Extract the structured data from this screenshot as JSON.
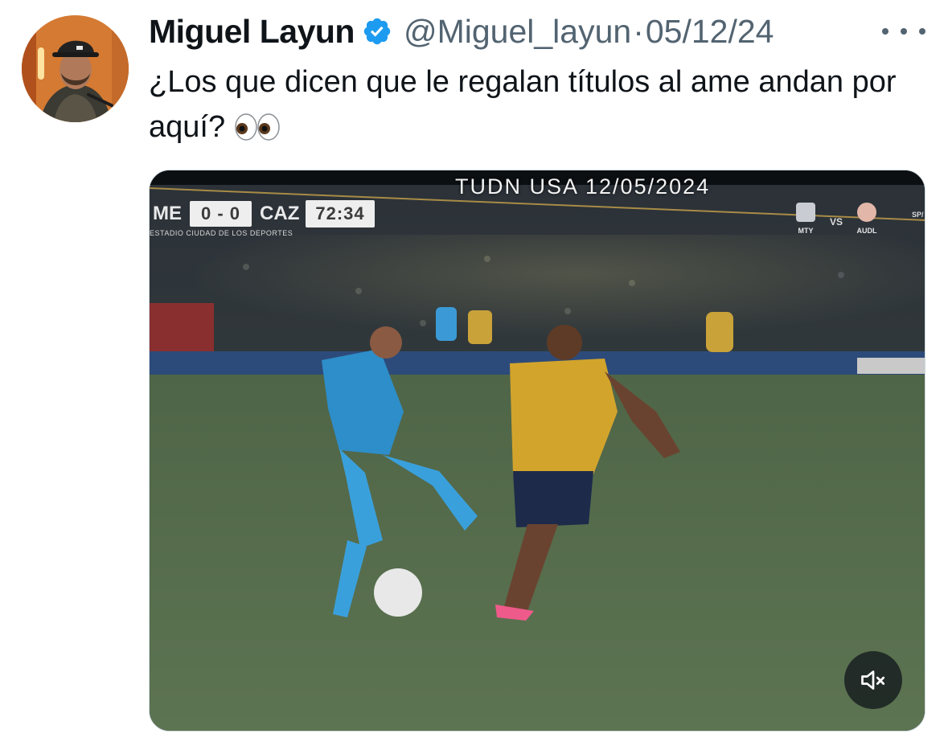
{
  "tweet": {
    "author_name": "Miguel Layun",
    "handle": "@Miguel_layun",
    "separator": "·",
    "date": "05/12/24",
    "text": "¿Los que dicen que le regalan títulos al ame andan por aquí?",
    "emoji": "👀"
  },
  "video": {
    "broadcast_banner": "TUDN USA 12/05/2024",
    "scorebug": {
      "home_team": "ME",
      "score": "0 - 0",
      "away_team": "CAZ",
      "clock": "72:34",
      "venue": "ESTADIO CIUDAD DE LOS DEPORTES"
    },
    "other_match": {
      "home": "MTY",
      "vs": "VS",
      "away": "AUDL",
      "extra": "SP/"
    },
    "muted": true
  },
  "icons": {
    "verified": "verified-badge-icon",
    "more": "more-options-icon",
    "mute": "volume-muted-icon"
  },
  "colors": {
    "verified_blue": "#1d9bf0",
    "secondary_text": "#536471",
    "primary_text": "#0f1419"
  }
}
